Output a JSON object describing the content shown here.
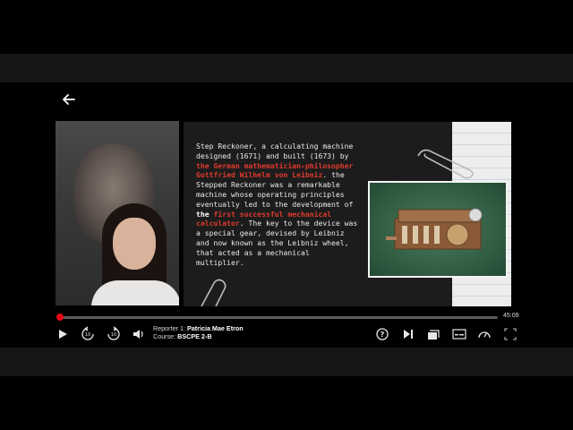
{
  "player": {
    "time_remaining": "45:09",
    "progress": 0.002,
    "reporter_label": "Reporter 1:",
    "reporter_name": "Patricia Mae Etron",
    "course_label": "Course:",
    "course_name": "BSCPE 2-B",
    "accent_color": "#e50914",
    "icons": [
      "back-arrow-icon",
      "play-icon",
      "rewind-10-icon",
      "forward-10-icon",
      "volume-icon",
      "help-icon",
      "next-episode-icon",
      "episodes-icon",
      "subtitles-icon",
      "speed-icon",
      "fullscreen-icon"
    ]
  },
  "slide": {
    "text_1": "Step Reckoner, a calculating machine designed (1671) and built (1673) by ",
    "text_red_1": "the German mathematician-philosopher Gottfried Wilhelm von Leibniz",
    "text_2": ". the Stepped Reckoner was a remarkable machine whose operating principles eventually led to the development of ",
    "text_bold": "the",
    "text_red_2": "first successful mechanical calculator",
    "text_3": ". The key to the device was a special gear, devised by Leibniz and now known as the Leibniz wheel, that acted as a mechanical multiplier."
  }
}
